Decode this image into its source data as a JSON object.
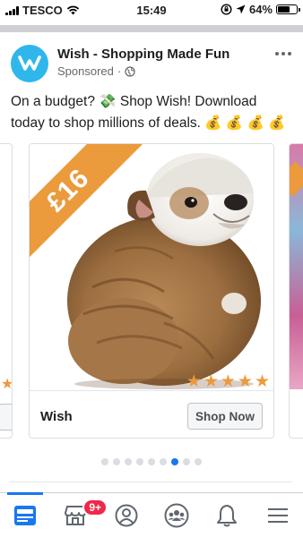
{
  "status_bar": {
    "carrier": "TESCO",
    "time": "15:49",
    "battery": "64%",
    "battery_level": 0.64
  },
  "post": {
    "page_name": "Wish - Shopping Made Fun",
    "sponsored_label": "Sponsored",
    "separator": "·",
    "text": "On a budget? 💸  Shop Wish! Download today to shop millions of deals. 💰 💰 💰 💰"
  },
  "carousel": {
    "main_card": {
      "price": "£16",
      "title": "Wish",
      "cta": "Shop Now",
      "rating": 5
    },
    "page_count": 9,
    "active_page": 7
  },
  "bottom_nav": {
    "tabs": [
      {
        "name": "news-feed",
        "icon": "news-feed-icon"
      },
      {
        "name": "marketplace",
        "icon": "marketplace-icon",
        "badge": "9+"
      },
      {
        "name": "profile",
        "icon": "profile-icon"
      },
      {
        "name": "groups",
        "icon": "groups-icon"
      },
      {
        "name": "notifications",
        "icon": "bell-icon"
      },
      {
        "name": "menu",
        "icon": "menu-icon"
      }
    ]
  },
  "colors": {
    "accent": "#1877f2",
    "price_tag": "#eb9a3c",
    "badge": "#f02849",
    "wish_logo": "#2fb7ec"
  }
}
